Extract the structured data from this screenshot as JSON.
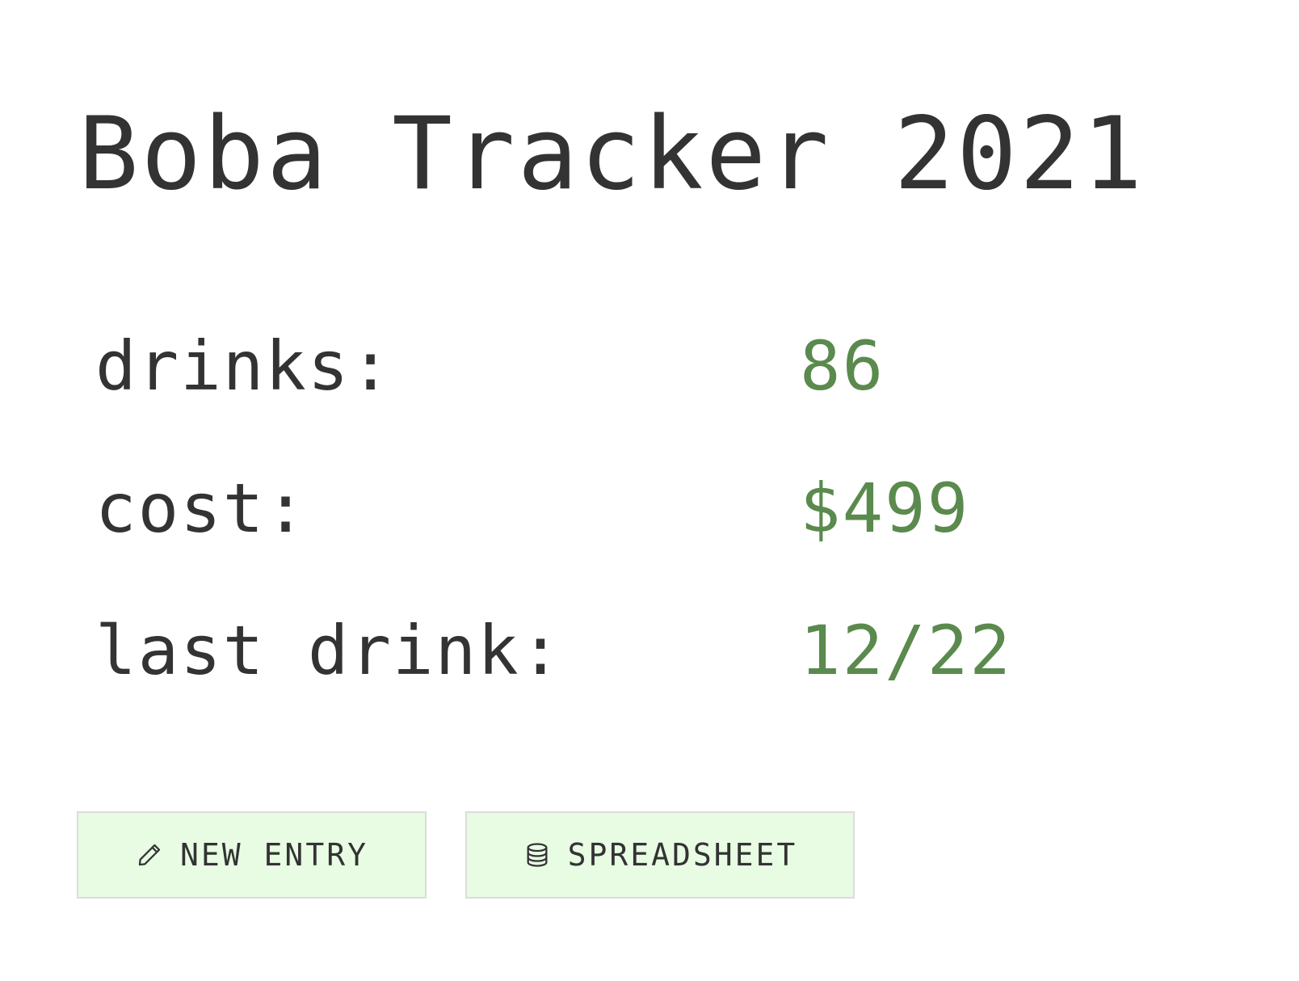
{
  "header": {
    "title": "Boba Tracker 2021"
  },
  "stats": [
    {
      "label": "drinks:",
      "value": "86"
    },
    {
      "label": "cost:",
      "value": "$499"
    },
    {
      "label": "last drink:",
      "value": "12/22"
    }
  ],
  "actions": {
    "new_entry": {
      "label": "NEW ENTRY",
      "icon": "pencil-icon"
    },
    "spreadsheet": {
      "label": "SPREADSHEET",
      "icon": "database-icon"
    }
  },
  "colors": {
    "text": "#333333",
    "value": "#5a8a4d",
    "button_bg": "#e8fce4",
    "button_border": "#dcdcdc"
  }
}
